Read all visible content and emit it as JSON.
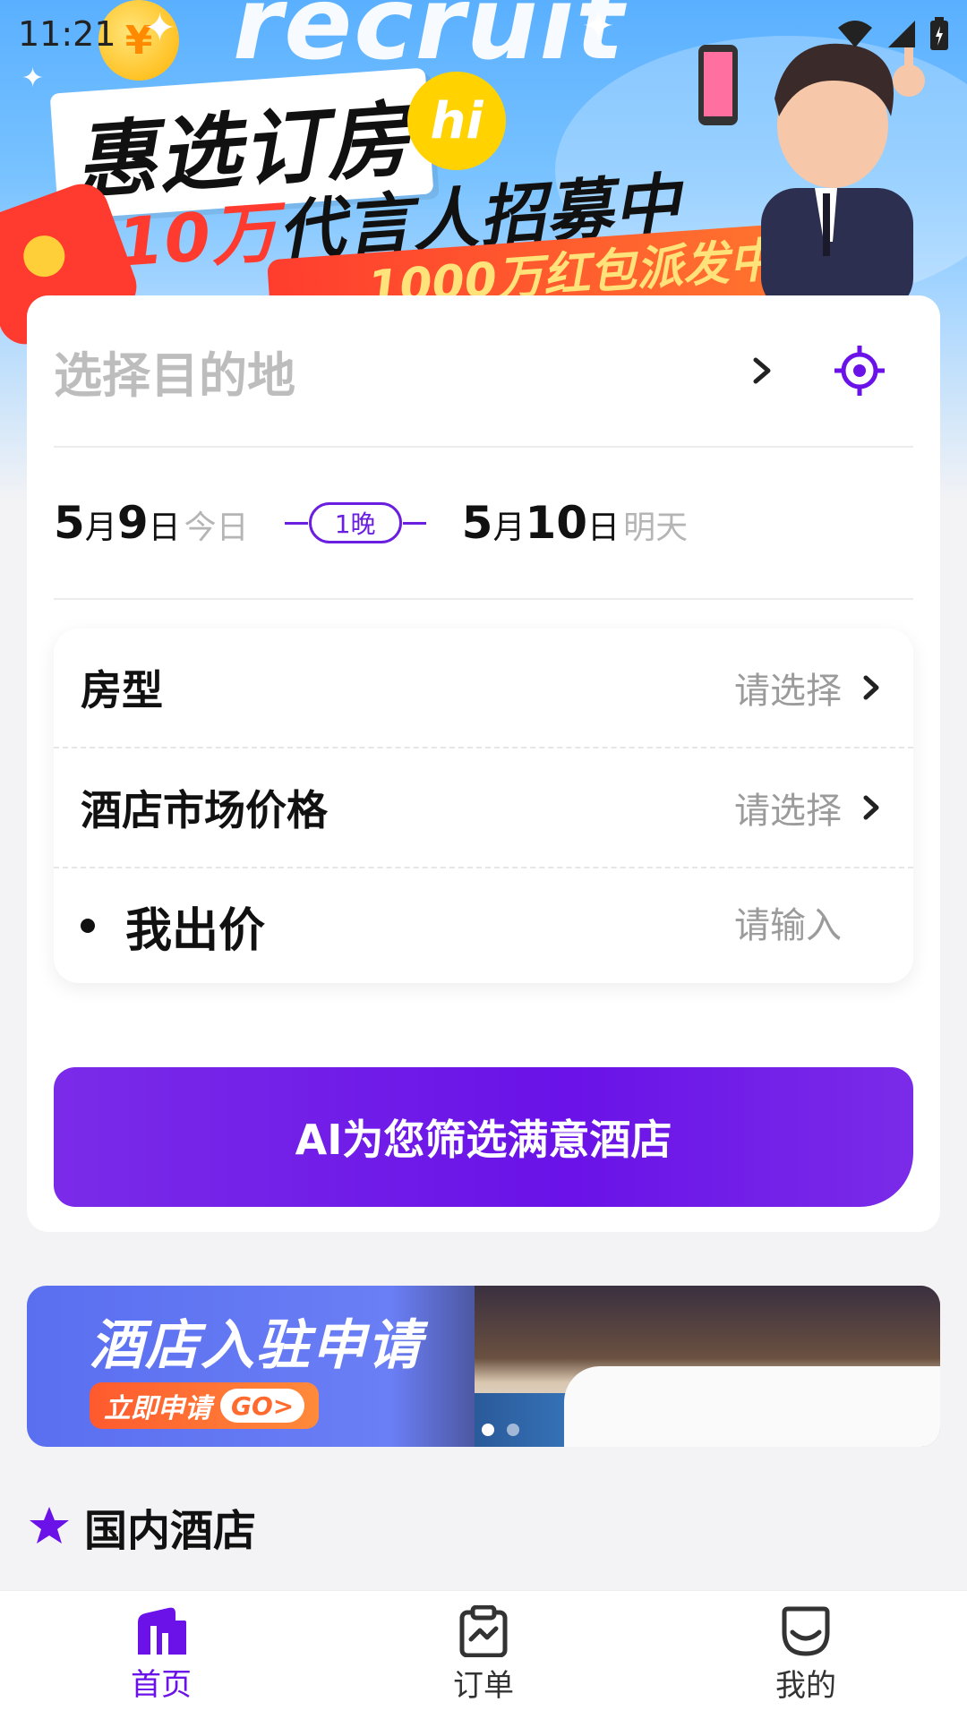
{
  "status_bar": {
    "time": "11:21"
  },
  "banner": {
    "recruit_text": "recruit",
    "title_main": "惠选订房",
    "hi": "hi",
    "title_sub_number": "10万",
    "title_sub_text": "代言人招募中",
    "red_bar_text": "1000万红包派发中 >",
    "coin_symbol": "¥"
  },
  "search": {
    "destination_placeholder": "选择目的地",
    "checkin": {
      "month": "5",
      "month_unit": "月",
      "day": "9",
      "day_unit": "日",
      "note": "今日"
    },
    "nights": "1晚",
    "checkout": {
      "month": "5",
      "month_unit": "月",
      "day": "10",
      "day_unit": "日",
      "note": "明天"
    }
  },
  "options": {
    "room_type": {
      "label": "房型",
      "value": "请选择"
    },
    "market_price": {
      "label": "酒店市场价格",
      "value": "请选择"
    },
    "my_price": {
      "label": "我出价",
      "placeholder": "请输入"
    }
  },
  "ai_button": {
    "label": "AI为您筛选满意酒店"
  },
  "join_banner": {
    "title": "酒店入驻申请",
    "apply_label": "立即申请",
    "go_label": "GO>",
    "active_index": 0,
    "slide_count": 2
  },
  "section": {
    "title": "国内酒店"
  },
  "bottom_nav": {
    "items": [
      {
        "label": "首页",
        "icon": "home-icon",
        "active": true
      },
      {
        "label": "订单",
        "icon": "order-icon",
        "active": false
      },
      {
        "label": "我的",
        "icon": "profile-icon",
        "active": false
      }
    ]
  },
  "colors": {
    "accent": "#6a12e8",
    "banner_blue": "#5ab0ff",
    "red": "#ff3b2f"
  }
}
